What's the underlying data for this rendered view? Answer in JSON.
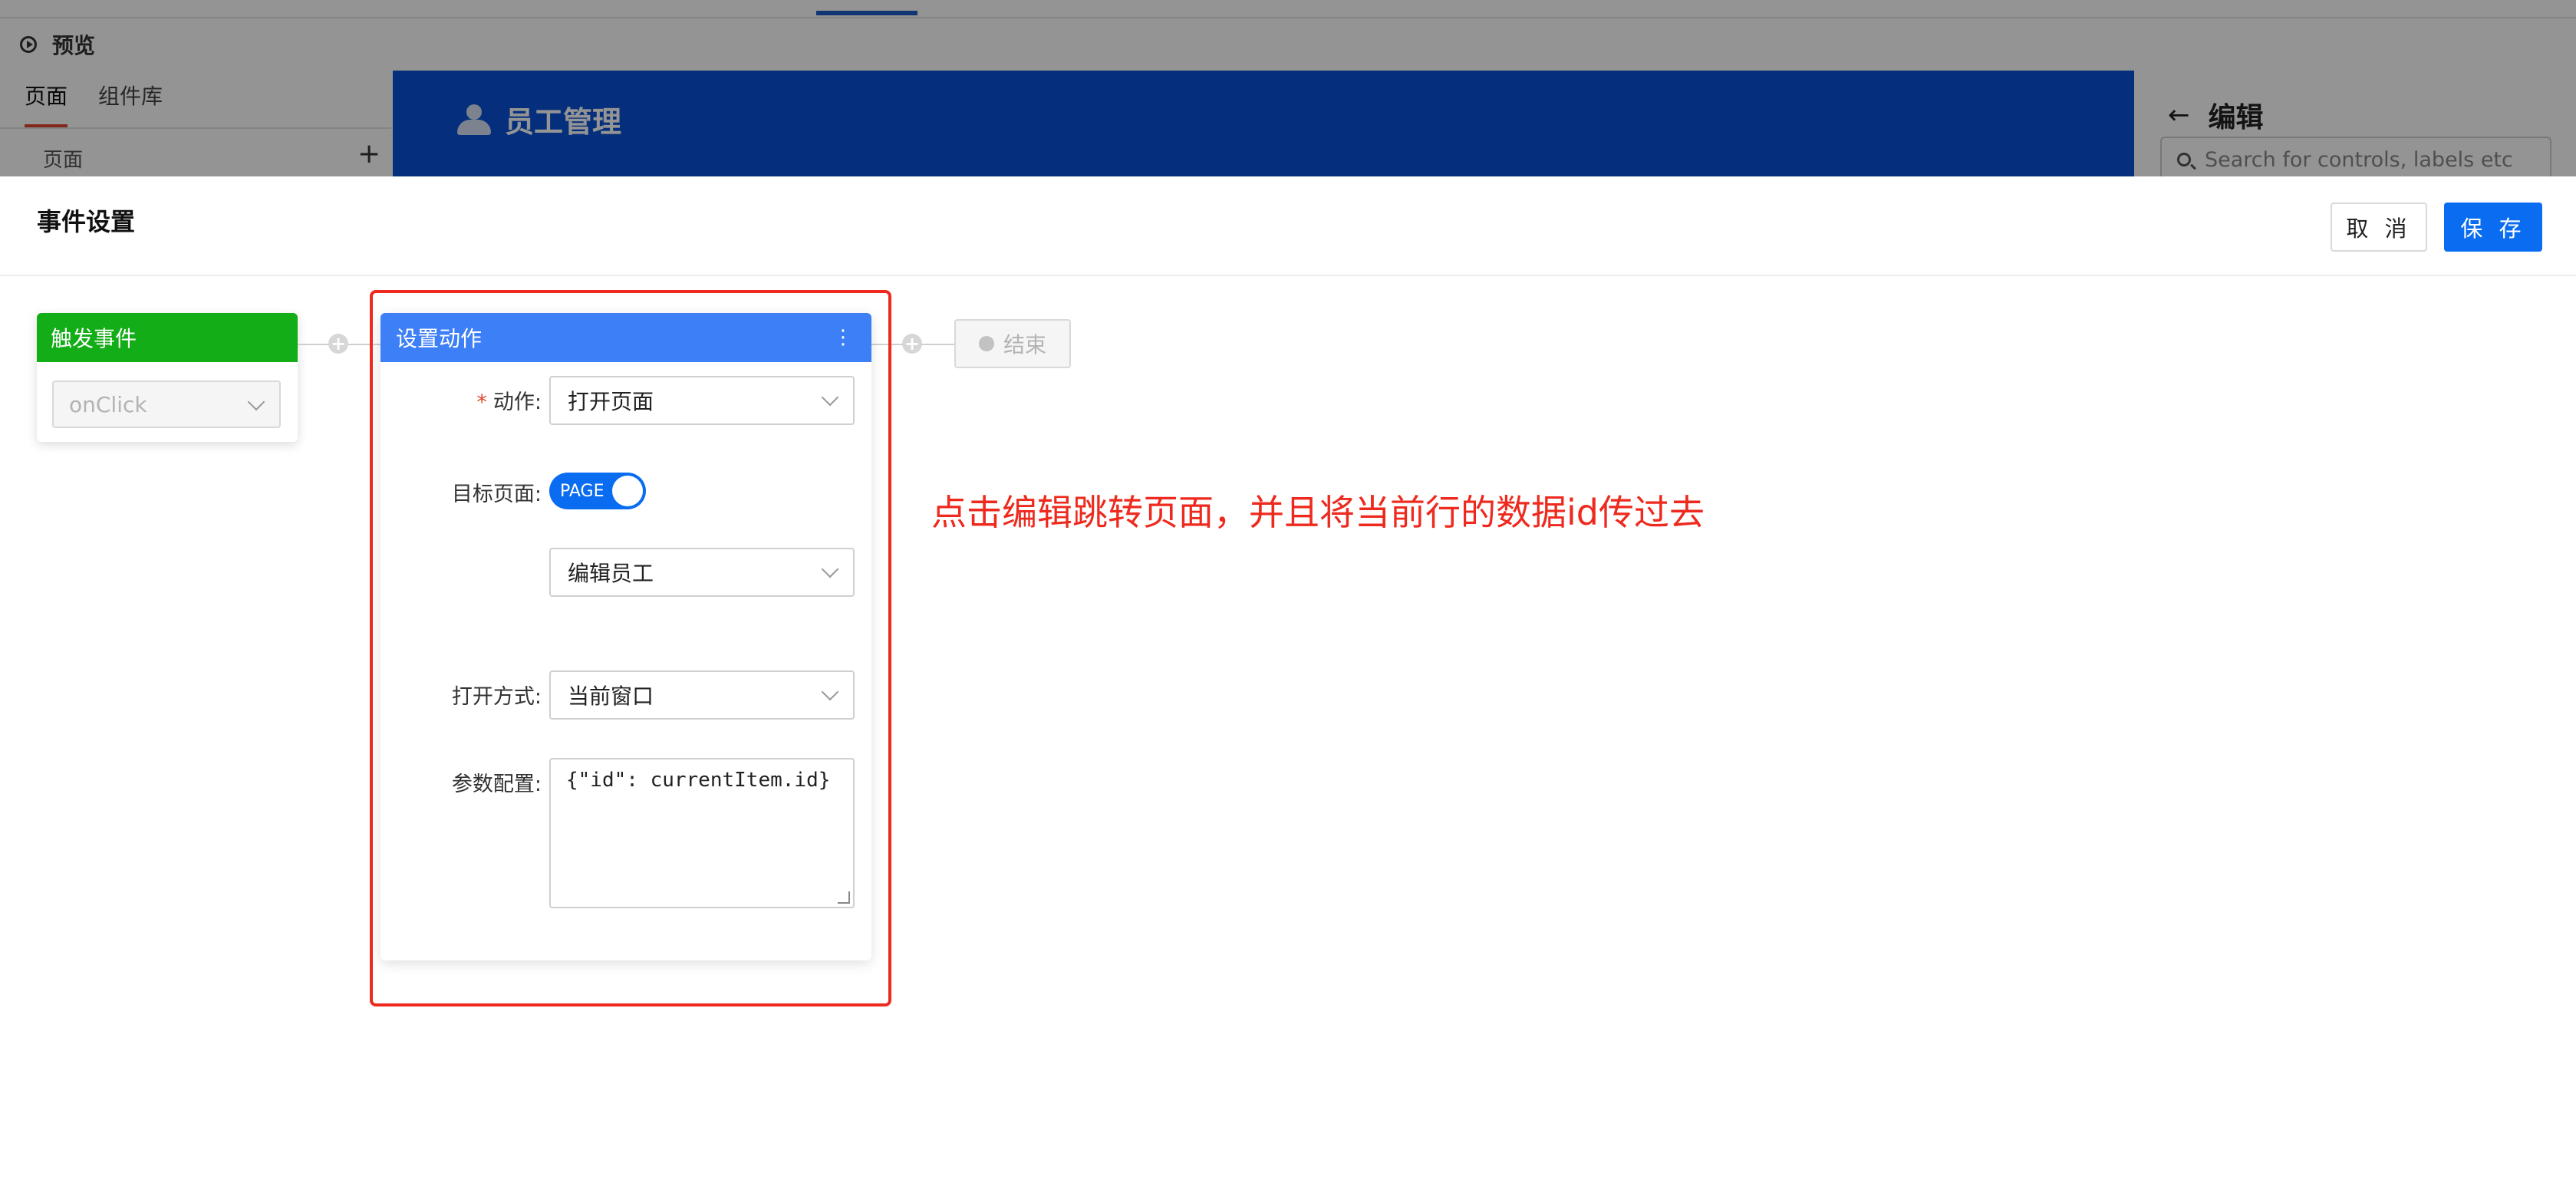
{
  "background": {
    "preview_label": "预览",
    "tabs": [
      {
        "label": "页面",
        "active": true
      },
      {
        "label": "组件库",
        "active": false
      }
    ],
    "pages_label": "页面",
    "add_icon": "plus-icon",
    "app_title": "员工管理",
    "edit_title": "编辑",
    "search_placeholder": "Search for controls, labels etc"
  },
  "modal": {
    "title": "事件设置",
    "cancel_label": "取 消",
    "save_label": "保 存"
  },
  "trigger": {
    "header": "触发事件",
    "event_value": "onClick",
    "color": "#13ad17"
  },
  "action": {
    "header": "设置动作",
    "color": "#3d7ff6",
    "fields": {
      "action_label": "动作:",
      "action_value": "打开页面",
      "target_label": "目标页面:",
      "toggle_text": "PAGE",
      "target_page_value": "编辑员工",
      "open_mode_label": "打开方式:",
      "open_mode_value": "当前窗口",
      "params_label": "参数配置:",
      "params_value": "{\"id\": currentItem.id}"
    }
  },
  "end": {
    "label": "结束"
  },
  "annotation": {
    "text": "点击编辑跳转页面，并且将当前行的数据id传过去",
    "color": "#ee2a1e"
  }
}
